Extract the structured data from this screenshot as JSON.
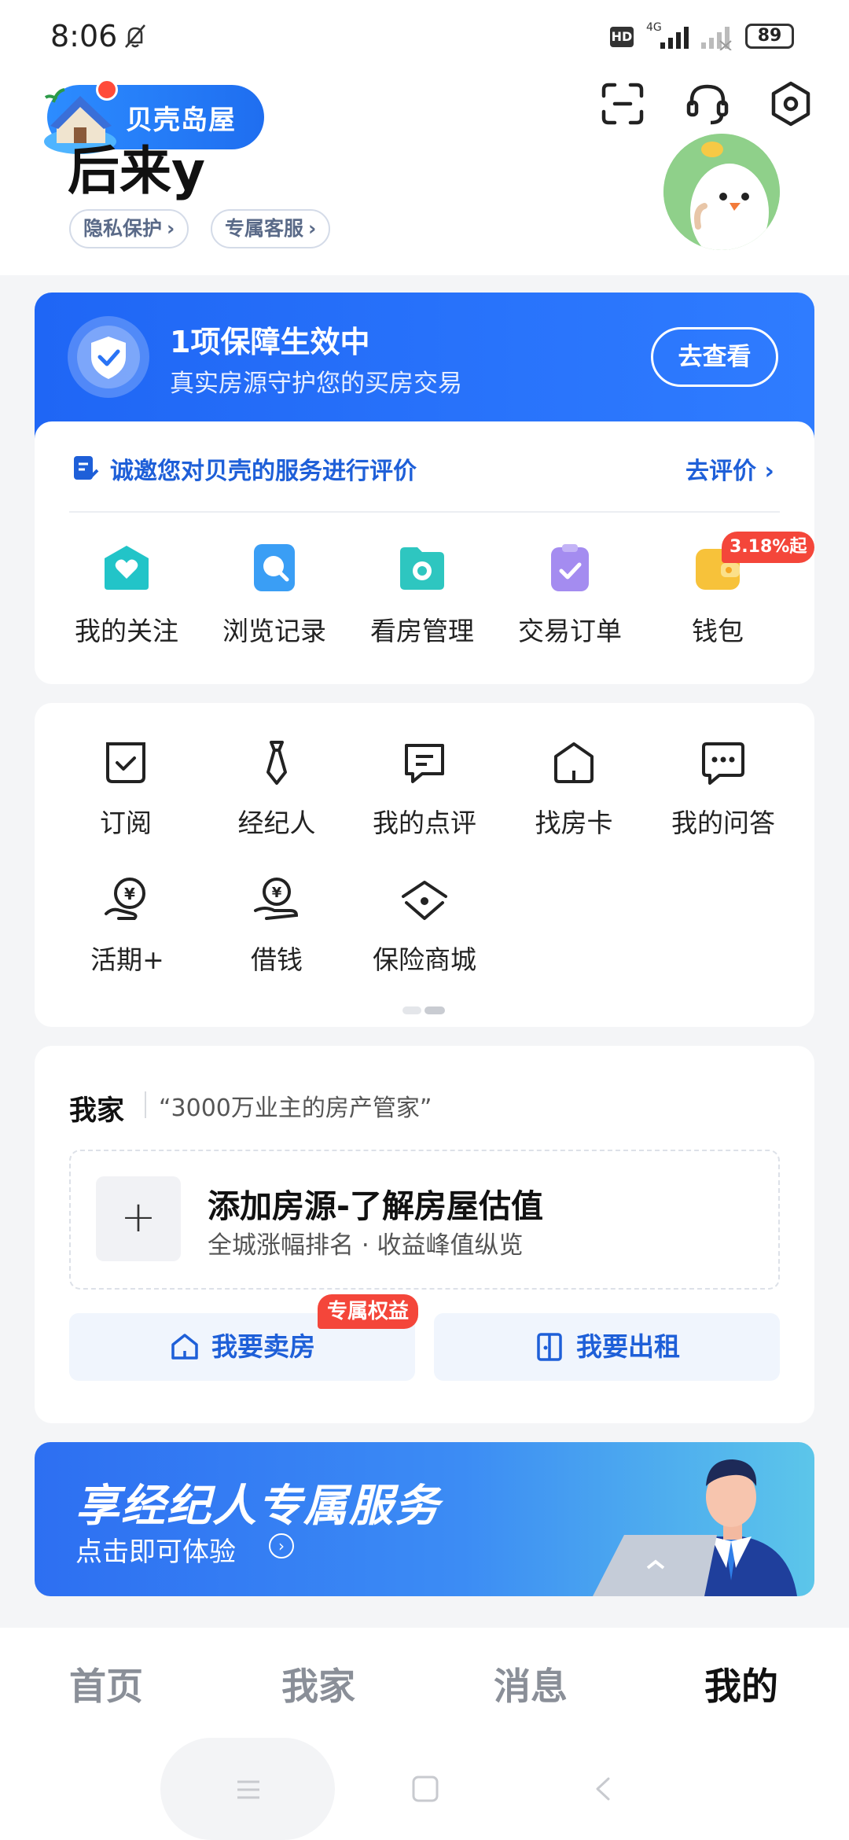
{
  "status_bar": {
    "time": "8:06",
    "hd_label": "HD",
    "network_label": "4G",
    "battery": "89"
  },
  "header": {
    "island_label": "贝壳岛屋",
    "username": "后来y",
    "chips": [
      "隐私保护",
      "专属客服"
    ],
    "icons": [
      "scan-icon",
      "headset-icon",
      "settings-icon"
    ]
  },
  "guarantee": {
    "title": "1项保障生效中",
    "subtitle": "真实房源守护您的买房交易",
    "button": "去查看"
  },
  "review_invite": {
    "text": "诚邀您对贝壳的服务进行评价",
    "link": "去评价"
  },
  "shortcuts": [
    {
      "label": "我的关注",
      "icon": "heart-house-icon",
      "color": "#22c4c8"
    },
    {
      "label": "浏览记录",
      "icon": "browse-icon",
      "color": "#3a9ef5"
    },
    {
      "label": "看房管理",
      "icon": "folder-eye-icon",
      "color": "#2ec6c0"
    },
    {
      "label": "交易订单",
      "icon": "clipboard-check-icon",
      "color": "#a48cf0"
    },
    {
      "label": "钱包",
      "icon": "wallet-icon",
      "color": "#f7c23a"
    }
  ],
  "wallet_badge": "3.18%起",
  "tools": [
    {
      "label": "订阅",
      "icon": "subscribe-icon"
    },
    {
      "label": "经纪人",
      "icon": "agent-tie-icon"
    },
    {
      "label": "我的点评",
      "icon": "review-icon"
    },
    {
      "label": "找房卡",
      "icon": "house-card-icon"
    },
    {
      "label": "我的问答",
      "icon": "qa-icon"
    },
    {
      "label": "活期+",
      "icon": "coin-hand-icon"
    },
    {
      "label": "借钱",
      "icon": "loan-icon"
    },
    {
      "label": "保险商城",
      "icon": "insurance-icon"
    }
  ],
  "my_home": {
    "title": "我家",
    "slogan": "“3000万业主的房产管家”",
    "add_title": "添加房源-了解房屋估值",
    "add_subtitle": "全城涨幅排名 · 收益峰值纵览",
    "sell_label": "我要卖房",
    "rent_label": "我要出租",
    "perk_badge": "专属权益"
  },
  "banner": {
    "title": "享经纪人专属服务",
    "subtitle": "点击即可体验"
  },
  "bottom_nav": {
    "items": [
      "首页",
      "我家",
      "消息",
      "我的"
    ],
    "active": "我的"
  }
}
